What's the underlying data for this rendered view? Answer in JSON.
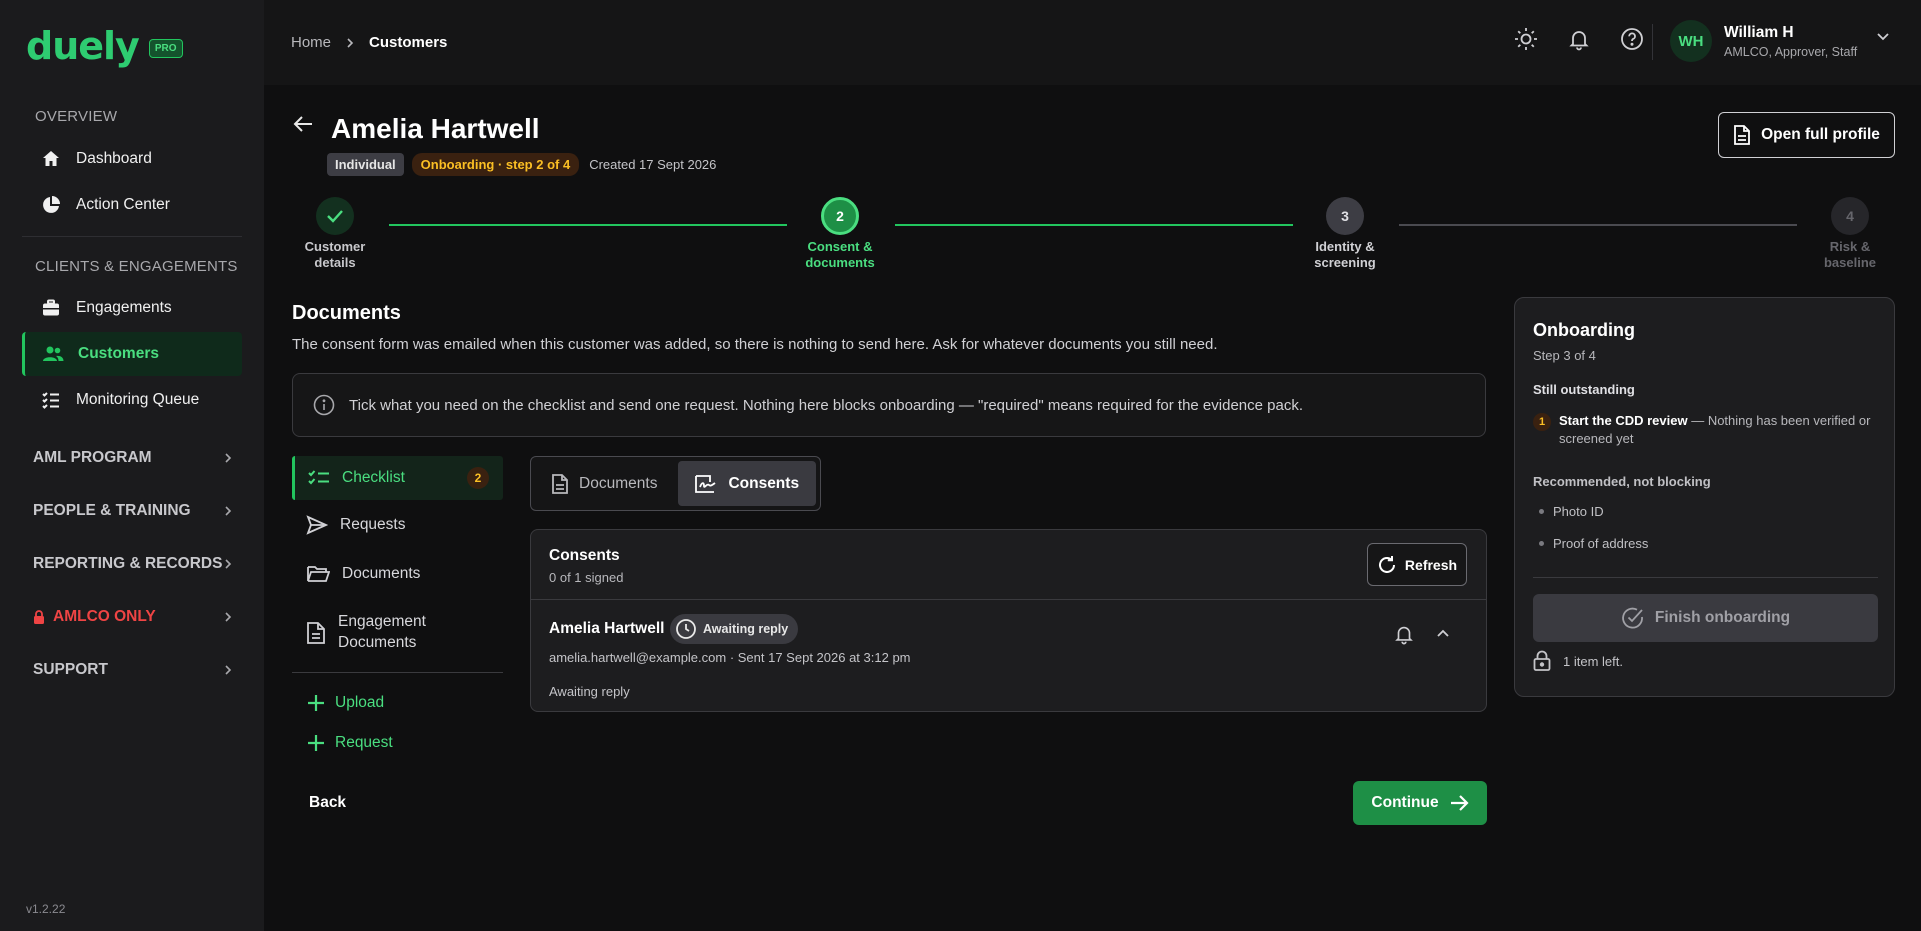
{
  "app": {
    "logo": "duely",
    "badge": "PRO",
    "version": "v1.2.22"
  },
  "sidebar": {
    "sections": [
      {
        "label": "OVERVIEW"
      },
      {
        "label": "CLIENTS & ENGAGEMENTS"
      }
    ],
    "items": [
      {
        "label": "Dashboard",
        "icon": "home-icon"
      },
      {
        "label": "Action Center",
        "icon": "pie-chart-icon"
      },
      {
        "label": "Engagements",
        "icon": "briefcase-icon"
      },
      {
        "label": "Customers",
        "icon": "users-icon",
        "active": true
      },
      {
        "label": "Monitoring Queue",
        "icon": "list-check-icon"
      }
    ],
    "groups": [
      {
        "label": "AML PROGRAM"
      },
      {
        "label": "PEOPLE & TRAINING"
      },
      {
        "label": "REPORTING & RECORDS"
      },
      {
        "label": "AMLCO ONLY",
        "icon": "lock-icon",
        "color": "#ef4444"
      },
      {
        "label": "SUPPORT"
      }
    ]
  },
  "topbar": {
    "breadcrumb": [
      "Home",
      "Customers"
    ],
    "icons": [
      "sun-icon",
      "bell-icon",
      "help-icon"
    ],
    "user": {
      "initials": "WH",
      "name": "William H",
      "role": "AMLCO, Approver, Staff"
    }
  },
  "customer": {
    "name": "Amelia Hartwell",
    "type": "Individual",
    "status": "Onboarding · step 2 of 4",
    "created": "Created 17 Sept 2026",
    "open_profile": "Open full profile"
  },
  "stepper": {
    "steps": [
      {
        "num": "1",
        "label": [
          "Customer",
          "details"
        ],
        "state": "done"
      },
      {
        "num": "2",
        "label": [
          "Consent &",
          "documents"
        ],
        "state": "current"
      },
      {
        "num": "3",
        "label": [
          "Identity &",
          "screening"
        ],
        "state": "upcoming"
      },
      {
        "num": "4",
        "label": [
          "Risk &",
          "baseline"
        ],
        "state": "disabled"
      }
    ]
  },
  "documents": {
    "title": "Documents",
    "description": "The consent form was emailed when this customer was added, so there is nothing to send here. Ask for whatever documents you still need.",
    "info": "Tick what you need on the checklist and send one request. Nothing here blocks onboarding — \"required\" means required for the evidence pack."
  },
  "subnav": {
    "items": [
      {
        "label": "Checklist",
        "icon": "checklist-icon",
        "count": "2",
        "active": true
      },
      {
        "label": "Requests",
        "icon": "send-icon"
      },
      {
        "label": "Documents",
        "icon": "folder-icon"
      },
      {
        "label": "Engagement Documents",
        "icon": "file-text-icon"
      }
    ],
    "actions": [
      {
        "label": "Upload"
      },
      {
        "label": "Request"
      }
    ]
  },
  "tabs": [
    {
      "label": "Documents",
      "icon": "file-icon"
    },
    {
      "label": "Consents",
      "icon": "signature-icon",
      "active": true
    }
  ],
  "consents": {
    "title": "Consents",
    "count": "0 of 1 signed",
    "refresh": "Refresh",
    "entry": {
      "name": "Amelia Hartwell",
      "badge": "Awaiting reply",
      "meta": "amelia.hartwell@example.com · Sent 17 Sept 2026 at 3:12 pm",
      "status": "Awaiting reply"
    }
  },
  "footer": {
    "back": "Back",
    "continue": "Continue"
  },
  "panel": {
    "title": "Onboarding",
    "step": "Step 3 of 4",
    "outstanding_heading": "Still outstanding",
    "outstanding": [
      {
        "num": "1",
        "strong": "Start the CDD review",
        "text": " — Nothing has been verified or screened yet"
      }
    ],
    "recommended_heading": "Recommended, not blocking",
    "recommended": [
      "Photo ID",
      "Proof of address"
    ],
    "finish": "Finish onboarding",
    "items_left": "1 item left."
  },
  "colors": {
    "accent": "#22c55e",
    "warning": "#fbbf24",
    "danger": "#ef4444"
  }
}
